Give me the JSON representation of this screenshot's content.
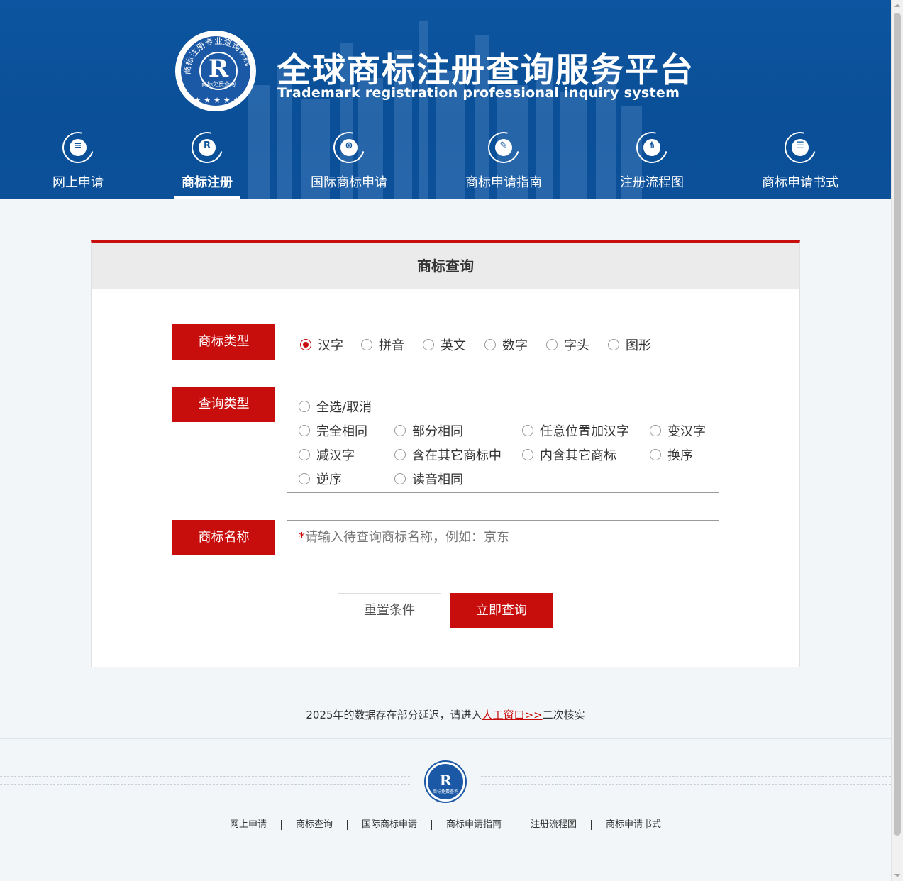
{
  "brand": {
    "title_cn": "全球商标注册查询服务平台",
    "title_en": "Trademark registration professional inquiry system",
    "logo_letter": "R",
    "logo_arc_text": "商标注册专业查询系统",
    "logo_sub": "商标免费查询"
  },
  "nav": [
    {
      "label": "网上申请",
      "icon": "application-form-icon",
      "glyph": "≡"
    },
    {
      "label": "商标注册",
      "icon": "trademark-r-icon",
      "glyph": "R",
      "active": true
    },
    {
      "label": "国际商标申请",
      "icon": "global-doc-icon",
      "glyph": "⊕"
    },
    {
      "label": "商标申请指南",
      "icon": "guide-doc-icon",
      "glyph": "✎"
    },
    {
      "label": "注册流程图",
      "icon": "flowchart-icon",
      "glyph": "⋔"
    },
    {
      "label": "商标申请书式",
      "icon": "form-doc-icon",
      "glyph": "☰"
    }
  ],
  "panel": {
    "title": "商标查询",
    "type_label": "商标类型",
    "type_options": [
      "汉字",
      "拼音",
      "英文",
      "数字",
      "字头",
      "图形"
    ],
    "type_selected": "汉字",
    "query_label": "查询类型",
    "query_options": [
      "全选/取消",
      "完全相同",
      "部分相同",
      "任意位置加汉字",
      "变汉字",
      "减汉字",
      "含在其它商标中",
      "内含其它商标",
      "换序",
      "逆序",
      "读音相同"
    ],
    "name_label": "商标名称",
    "name_required_mark": "*",
    "name_placeholder": "请输入待查询商标名称，例如：京东",
    "reset_label": "重置条件",
    "search_label": "立即查询"
  },
  "notice": {
    "before": "2025年的数据存在部分延迟，请进入",
    "link": "人工窗口>>",
    "after": "二次核实"
  },
  "footer": {
    "logo_letter": "R",
    "logo_sub": "商标免费查询",
    "links": [
      "网上申请",
      "商标查询",
      "国际商标申请",
      "商标申请指南",
      "注册流程图",
      "商标申请书式"
    ]
  },
  "colors": {
    "header_blue": "#0b519b",
    "accent_red": "#c80d0d"
  }
}
